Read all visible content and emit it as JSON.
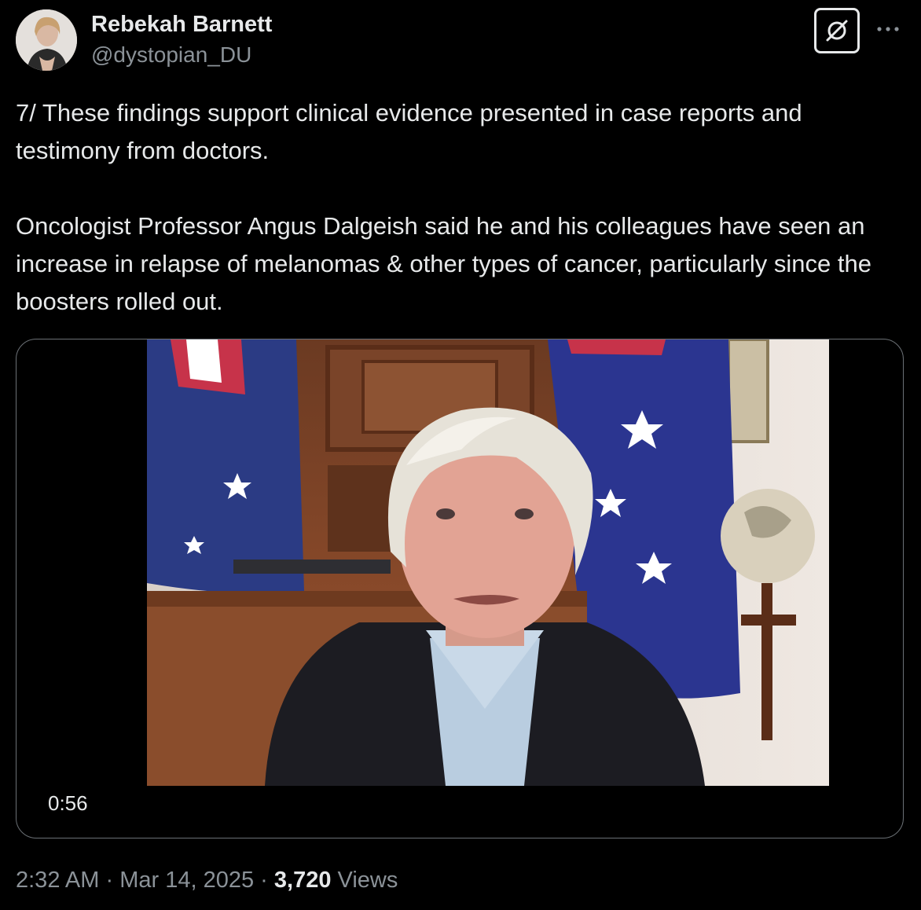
{
  "author": {
    "display_name": "Rebekah Barnett",
    "handle": "@dystopian_DU"
  },
  "post": {
    "paragraphs": [
      "7/ These findings support clinical evidence presented in case reports and testimony from doctors.",
      "Oncologist Professor Angus Dalgeish said he and his colleagues have seen an increase in relapse of melanomas & other types of cancer, particularly since the boosters rolled out."
    ]
  },
  "media": {
    "duration": "0:56"
  },
  "meta": {
    "time": "2:32 AM",
    "separator": "·",
    "date": "Mar 14, 2025",
    "views_count": "3,720",
    "views_label": "Views"
  },
  "icons": {
    "grok": "grok-icon",
    "more": "more-dots-icon"
  },
  "colors": {
    "background": "#000000",
    "primary_text": "#e7e9ea",
    "secondary_text": "#8b9298",
    "border": "#6b7075"
  }
}
